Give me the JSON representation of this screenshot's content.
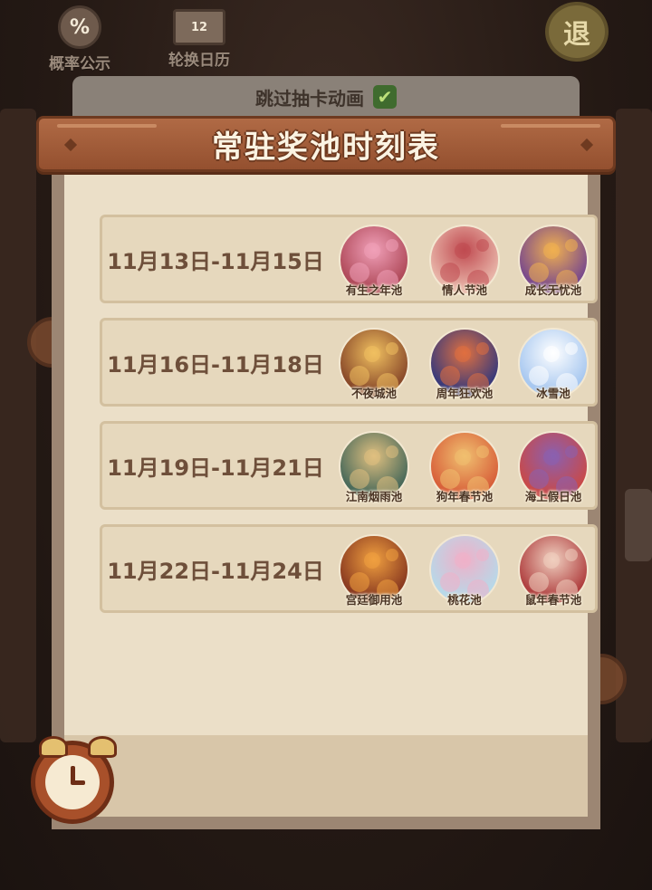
{
  "topbar": {
    "probability_label": "概率公示",
    "probability_icon": "%",
    "calendar_label": "轮换日历",
    "calendar_icon": "12",
    "exit_label": "退"
  },
  "skip": {
    "label": "跳过抽卡动画",
    "checked": true
  },
  "banner": {
    "title": "常驻奖池时刻表"
  },
  "schedule": [
    {
      "date": "11月13日-11月15日",
      "pools": [
        {
          "name": "有生之年池",
          "color": "#b04a5a",
          "accent": "#f0a0b8"
        },
        {
          "name": "情人节池",
          "color": "#e8b4a8",
          "accent": "#c04a50"
        },
        {
          "name": "成长无忧池",
          "color": "#7a4a8c",
          "accent": "#f0b050"
        }
      ]
    },
    {
      "date": "11月16日-11月18日",
      "pools": [
        {
          "name": "不夜城池",
          "color": "#8a4a2a",
          "accent": "#f0c060"
        },
        {
          "name": "周年狂欢池",
          "color": "#3a3a7a",
          "accent": "#e07040"
        },
        {
          "name": "冰雪池",
          "color": "#a8c8f0",
          "accent": "#ffffff"
        }
      ]
    },
    {
      "date": "11月19日-11月21日",
      "pools": [
        {
          "name": "江南烟雨池",
          "color": "#4a6a5a",
          "accent": "#e0c080"
        },
        {
          "name": "狗年春节池",
          "color": "#d8603a",
          "accent": "#f0c070"
        },
        {
          "name": "海上假日池",
          "color": "#c84a4a",
          "accent": "#8a60b0"
        }
      ]
    },
    {
      "date": "11月22日-11月24日",
      "pools": [
        {
          "name": "宫廷御用池",
          "color": "#8a3a20",
          "accent": "#f0a040"
        },
        {
          "name": "桃花池",
          "color": "#b8d8e8",
          "accent": "#f0b0c8"
        },
        {
          "name": "鼠年春节池",
          "color": "#b04040",
          "accent": "#f0d0c0"
        }
      ]
    }
  ],
  "colors": {
    "banner": "#a05a38",
    "paper": "#ebdfc8",
    "date_text": "#6e4f3a"
  }
}
